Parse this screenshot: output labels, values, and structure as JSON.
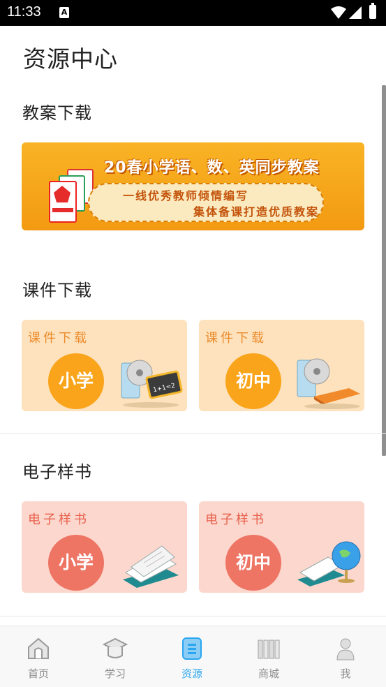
{
  "status_bar": {
    "time": "11:33",
    "notification_glyph": "A"
  },
  "page_title": "资源中心",
  "sections": {
    "lesson_plans": {
      "title": "教案下载",
      "banner": {
        "headline": "20春小学语、数、英同步教案",
        "line1": "一线优秀教师倾情编写",
        "line2": "集体备课打造优质教案"
      }
    },
    "courseware": {
      "title": "课件下载",
      "cards": [
        {
          "label": "课件下载",
          "level": "小学"
        },
        {
          "label": "课件下载",
          "level": "初中"
        }
      ]
    },
    "ebooks": {
      "title": "电子样书",
      "cards": [
        {
          "label": "电子样书",
          "level": "小学"
        },
        {
          "label": "电子样书",
          "level": "初中"
        }
      ]
    }
  },
  "tabs": [
    {
      "label": "首页",
      "icon": "home-icon",
      "active": false
    },
    {
      "label": "学习",
      "icon": "graduation-cap-icon",
      "active": false
    },
    {
      "label": "资源",
      "icon": "resources-icon",
      "active": true
    },
    {
      "label": "商城",
      "icon": "store-icon",
      "active": false
    },
    {
      "label": "我",
      "icon": "person-icon",
      "active": false
    }
  ],
  "colors": {
    "accent_blue": "#2aa6f0",
    "courseware_card_bg": "#fde2bd",
    "courseware_circle": "#f9a41a",
    "ebook_card_bg": "#fcd7cd",
    "ebook_circle": "#ee7464",
    "banner_orange": "#f39a12"
  }
}
